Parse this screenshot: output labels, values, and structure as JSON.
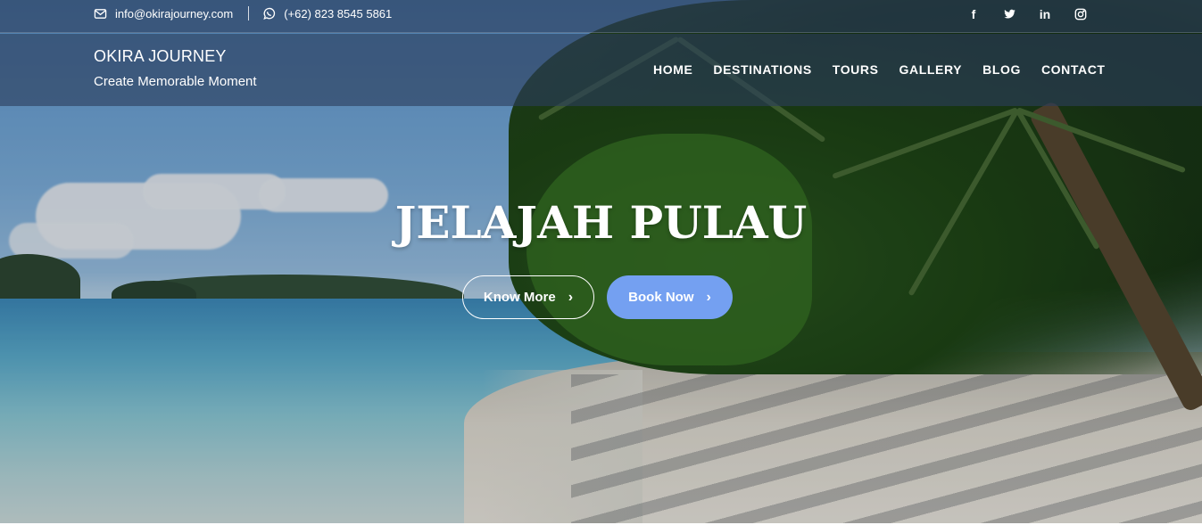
{
  "topbar": {
    "email": "info@okirajourney.com",
    "phone": "(+62) 823 8545 5861",
    "icons": [
      "envelope-icon",
      "whatsapp-icon"
    ],
    "social": [
      {
        "name": "facebook",
        "glyph": "f"
      },
      {
        "name": "twitter",
        "glyph": "🐦"
      },
      {
        "name": "linkedin",
        "glyph": "in"
      },
      {
        "name": "instagram",
        "glyph": "◎"
      }
    ]
  },
  "brand": {
    "title": "OKIRA JOURNEY",
    "tagline": "Create Memorable Moment"
  },
  "nav": {
    "items": [
      "HOME",
      "DESTINATIONS",
      "TOURS",
      "GALLERY",
      "BLOG",
      "CONTACT"
    ]
  },
  "hero": {
    "headline": "JELAJAH PULAU",
    "primary_button": "Know More",
    "secondary_button": "Book Now"
  },
  "colors": {
    "header_bg": "#2c3e5c",
    "accent": "#74a0f1"
  }
}
